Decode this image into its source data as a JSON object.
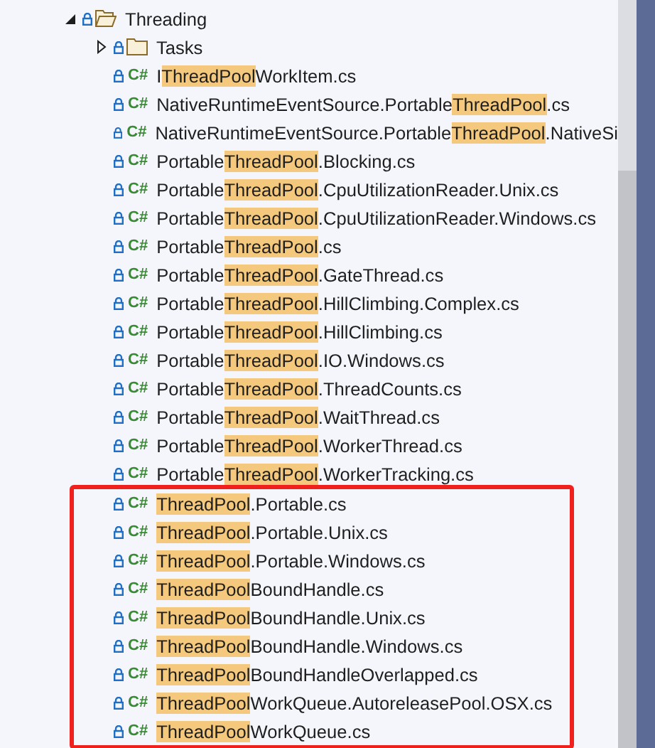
{
  "tree": {
    "label": "Threading",
    "expanded": true,
    "children": [
      {
        "kind": "folder",
        "label": [
          {
            "text": "Tasks",
            "match": false
          }
        ],
        "expanded": false,
        "boxed": false
      },
      {
        "kind": "file",
        "badge": "C#",
        "label": [
          {
            "text": "I",
            "match": false
          },
          {
            "text": "ThreadPool",
            "match": true
          },
          {
            "text": "WorkItem.cs",
            "match": false
          }
        ],
        "boxed": false
      },
      {
        "kind": "file",
        "badge": "C#",
        "label": [
          {
            "text": "NativeRuntimeEventSource.Portable",
            "match": false
          },
          {
            "text": "ThreadPool",
            "match": true
          },
          {
            "text": ".cs",
            "match": false
          }
        ],
        "boxed": false
      },
      {
        "kind": "file",
        "badge": "C#",
        "label": [
          {
            "text": "NativeRuntimeEventSource.Portable",
            "match": false
          },
          {
            "text": "ThreadPool",
            "match": true
          },
          {
            "text": ".NativeSi",
            "match": false
          }
        ],
        "boxed": false
      },
      {
        "kind": "file",
        "badge": "C#",
        "label": [
          {
            "text": "Portable",
            "match": false
          },
          {
            "text": "ThreadPool",
            "match": true
          },
          {
            "text": ".Blocking.cs",
            "match": false
          }
        ],
        "boxed": false
      },
      {
        "kind": "file",
        "badge": "C#",
        "label": [
          {
            "text": "Portable",
            "match": false
          },
          {
            "text": "ThreadPool",
            "match": true
          },
          {
            "text": ".CpuUtilizationReader.Unix.cs",
            "match": false
          }
        ],
        "boxed": false
      },
      {
        "kind": "file",
        "badge": "C#",
        "label": [
          {
            "text": "Portable",
            "match": false
          },
          {
            "text": "ThreadPool",
            "match": true
          },
          {
            "text": ".CpuUtilizationReader.Windows.cs",
            "match": false
          }
        ],
        "boxed": false
      },
      {
        "kind": "file",
        "badge": "C#",
        "label": [
          {
            "text": "Portable",
            "match": false
          },
          {
            "text": "ThreadPool",
            "match": true
          },
          {
            "text": ".cs",
            "match": false
          }
        ],
        "boxed": false
      },
      {
        "kind": "file",
        "badge": "C#",
        "label": [
          {
            "text": "Portable",
            "match": false
          },
          {
            "text": "ThreadPool",
            "match": true
          },
          {
            "text": ".GateThread.cs",
            "match": false
          }
        ],
        "boxed": false
      },
      {
        "kind": "file",
        "badge": "C#",
        "label": [
          {
            "text": "Portable",
            "match": false
          },
          {
            "text": "ThreadPool",
            "match": true
          },
          {
            "text": ".HillClimbing.Complex.cs",
            "match": false
          }
        ],
        "boxed": false
      },
      {
        "kind": "file",
        "badge": "C#",
        "label": [
          {
            "text": "Portable",
            "match": false
          },
          {
            "text": "ThreadPool",
            "match": true
          },
          {
            "text": ".HillClimbing.cs",
            "match": false
          }
        ],
        "boxed": false
      },
      {
        "kind": "file",
        "badge": "C#",
        "label": [
          {
            "text": "Portable",
            "match": false
          },
          {
            "text": "ThreadPool",
            "match": true
          },
          {
            "text": ".IO.Windows.cs",
            "match": false
          }
        ],
        "boxed": false
      },
      {
        "kind": "file",
        "badge": "C#",
        "label": [
          {
            "text": "Portable",
            "match": false
          },
          {
            "text": "ThreadPool",
            "match": true
          },
          {
            "text": ".ThreadCounts.cs",
            "match": false
          }
        ],
        "boxed": false
      },
      {
        "kind": "file",
        "badge": "C#",
        "label": [
          {
            "text": "Portable",
            "match": false
          },
          {
            "text": "ThreadPool",
            "match": true
          },
          {
            "text": ".WaitThread.cs",
            "match": false
          }
        ],
        "boxed": false
      },
      {
        "kind": "file",
        "badge": "C#",
        "label": [
          {
            "text": "Portable",
            "match": false
          },
          {
            "text": "ThreadPool",
            "match": true
          },
          {
            "text": ".WorkerThread.cs",
            "match": false
          }
        ],
        "boxed": false
      },
      {
        "kind": "file",
        "badge": "C#",
        "label": [
          {
            "text": "Portable",
            "match": false
          },
          {
            "text": "ThreadPool",
            "match": true
          },
          {
            "text": ".WorkerTracking.cs",
            "match": false
          }
        ],
        "boxed": false
      },
      {
        "kind": "file",
        "badge": "C#",
        "label": [
          {
            "text": "ThreadPool",
            "match": true
          },
          {
            "text": ".Portable.cs",
            "match": false
          }
        ],
        "boxed": true
      },
      {
        "kind": "file",
        "badge": "C#",
        "label": [
          {
            "text": "ThreadPool",
            "match": true
          },
          {
            "text": ".Portable.Unix.cs",
            "match": false
          }
        ],
        "boxed": true
      },
      {
        "kind": "file",
        "badge": "C#",
        "label": [
          {
            "text": "ThreadPool",
            "match": true
          },
          {
            "text": ".Portable.Windows.cs",
            "match": false
          }
        ],
        "boxed": true
      },
      {
        "kind": "file",
        "badge": "C#",
        "label": [
          {
            "text": "ThreadPool",
            "match": true
          },
          {
            "text": "BoundHandle.cs",
            "match": false
          }
        ],
        "boxed": true
      },
      {
        "kind": "file",
        "badge": "C#",
        "label": [
          {
            "text": "ThreadPool",
            "match": true
          },
          {
            "text": "BoundHandle.Unix.cs",
            "match": false
          }
        ],
        "boxed": true
      },
      {
        "kind": "file",
        "badge": "C#",
        "label": [
          {
            "text": "ThreadPool",
            "match": true
          },
          {
            "text": "BoundHandle.Windows.cs",
            "match": false
          }
        ],
        "boxed": true
      },
      {
        "kind": "file",
        "badge": "C#",
        "label": [
          {
            "text": "ThreadPool",
            "match": true
          },
          {
            "text": "BoundHandleOverlapped.cs",
            "match": false
          }
        ],
        "boxed": true
      },
      {
        "kind": "file",
        "badge": "C#",
        "label": [
          {
            "text": "ThreadPool",
            "match": true
          },
          {
            "text": "WorkQueue.AutoreleasePool.OSX.cs",
            "match": false
          }
        ],
        "boxed": true
      },
      {
        "kind": "file",
        "badge": "C#",
        "label": [
          {
            "text": "ThreadPool",
            "match": true
          },
          {
            "text": "WorkQueue.cs",
            "match": false
          }
        ],
        "boxed": true
      }
    ]
  }
}
